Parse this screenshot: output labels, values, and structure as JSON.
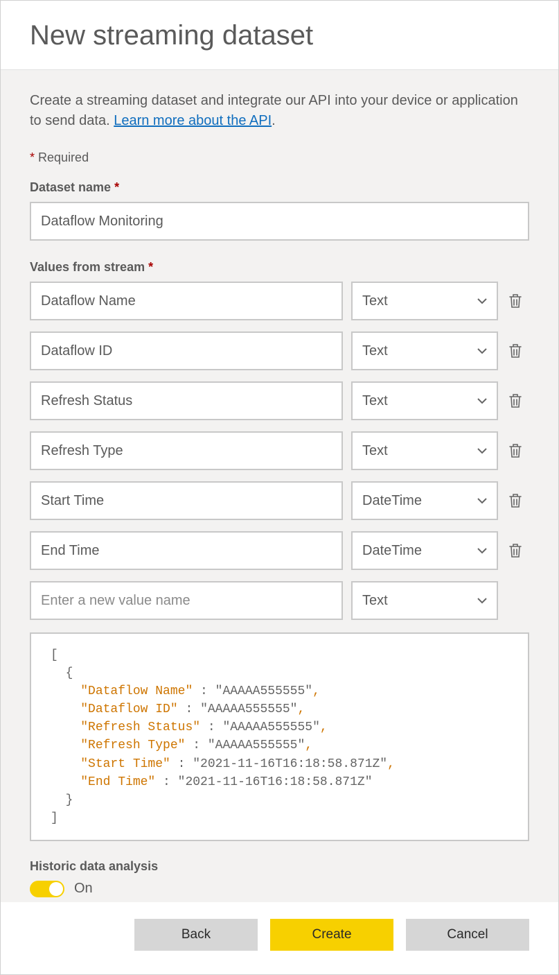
{
  "title": "New streaming dataset",
  "intro_text": "Create a streaming dataset and integrate our API into your device or application to send data. ",
  "intro_link": "Learn more about the API",
  "intro_period": ".",
  "required_label": "Required",
  "dataset_name_label": "Dataset name",
  "dataset_name_value": "Dataflow Monitoring",
  "values_label": "Values from stream",
  "stream_values": [
    {
      "name": "Dataflow Name",
      "type": "Text"
    },
    {
      "name": "Dataflow ID",
      "type": "Text"
    },
    {
      "name": "Refresh Status",
      "type": "Text"
    },
    {
      "name": "Refresh Type",
      "type": "Text"
    },
    {
      "name": "Start Time",
      "type": "DateTime"
    },
    {
      "name": "End Time",
      "type": "DateTime"
    }
  ],
  "new_value_placeholder": "Enter a new value name",
  "new_value_type": "Text",
  "code_preview": {
    "lines": [
      {
        "key": "Dataflow Name",
        "value": "AAAAA555555",
        "trailing_comma": true
      },
      {
        "key": "Dataflow ID",
        "value": "AAAAA555555",
        "trailing_comma": true
      },
      {
        "key": "Refresh Status",
        "value": "AAAAA555555",
        "trailing_comma": true
      },
      {
        "key": "Refresh Type",
        "value": "AAAAA555555",
        "trailing_comma": true
      },
      {
        "key": "Start Time",
        "value": "2021-11-16T16:18:58.871Z",
        "trailing_comma": true
      },
      {
        "key": "End Time",
        "value": "2021-11-16T16:18:58.871Z",
        "trailing_comma": false
      }
    ]
  },
  "historic_label": "Historic data analysis",
  "historic_state": "On",
  "buttons": {
    "back": "Back",
    "create": "Create",
    "cancel": "Cancel"
  }
}
